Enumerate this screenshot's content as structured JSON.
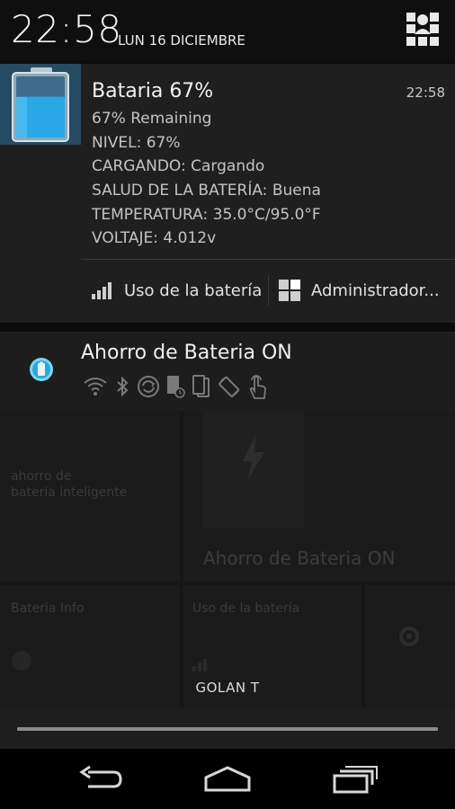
{
  "status_bar": {
    "time": "22:58",
    "date": "LUN 16 DICIEMBRE"
  },
  "battery_notification": {
    "title": "Bataria 67%",
    "time": "22:58",
    "lines": [
      "67% Remaining",
      "NIVEL: 67%",
      "CARGANDO: Cargando",
      "SALUD DE LA BATERÍA: Buena",
      "TEMPERATURA: 35.0°C/95.0°F",
      "VOLTAJE: 4.012v"
    ],
    "level_fraction": 0.67,
    "actions": {
      "usage": "Uso de la batería",
      "manager": "Administrador..."
    }
  },
  "saver_notification": {
    "title": "Ahorro de Bateria ON"
  },
  "background_tiles": {
    "left_text": "ahorro de\nbateria inteligente",
    "right_big": "Ahorro de Bateria ON",
    "bottom_left": "Bateria Info",
    "bottom_mid": "Uso de la batería"
  },
  "carrier": "GOLAN T",
  "colors": {
    "battery_fill": "#29a8e8",
    "thumb_bg": "#274a63",
    "accent": "#33b5e5"
  }
}
